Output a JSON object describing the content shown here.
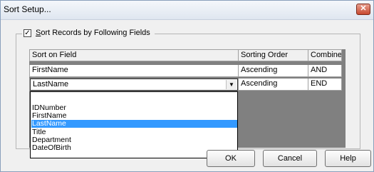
{
  "window": {
    "title": "Sort Setup...",
    "close_glyph": "✕"
  },
  "group": {
    "checkbox_checked": true,
    "check_glyph": "✓",
    "label_mnemonic": "S",
    "label_rest": "ort Records by Following Fields"
  },
  "grid": {
    "headers": [
      "Sort on Field",
      "Sorting Order",
      "Combine"
    ],
    "rows": [
      [
        "FirstName",
        "Ascending",
        "AND"
      ],
      [
        "LastName",
        "Ascending",
        "END"
      ]
    ]
  },
  "combo": {
    "value": "LastName",
    "arrow_glyph": "▼"
  },
  "dropdown": {
    "options": [
      "",
      "IDNumber",
      "FirstName",
      "LastName",
      "Title",
      "Department",
      "DateOfBirth"
    ],
    "selected_index": 3
  },
  "buttons": {
    "ok": "OK",
    "cancel": "Cancel",
    "help": "Help"
  },
  "colors": {
    "selection": "#3399ff",
    "grid_background": "#808080",
    "close_button": "#c8492f"
  }
}
